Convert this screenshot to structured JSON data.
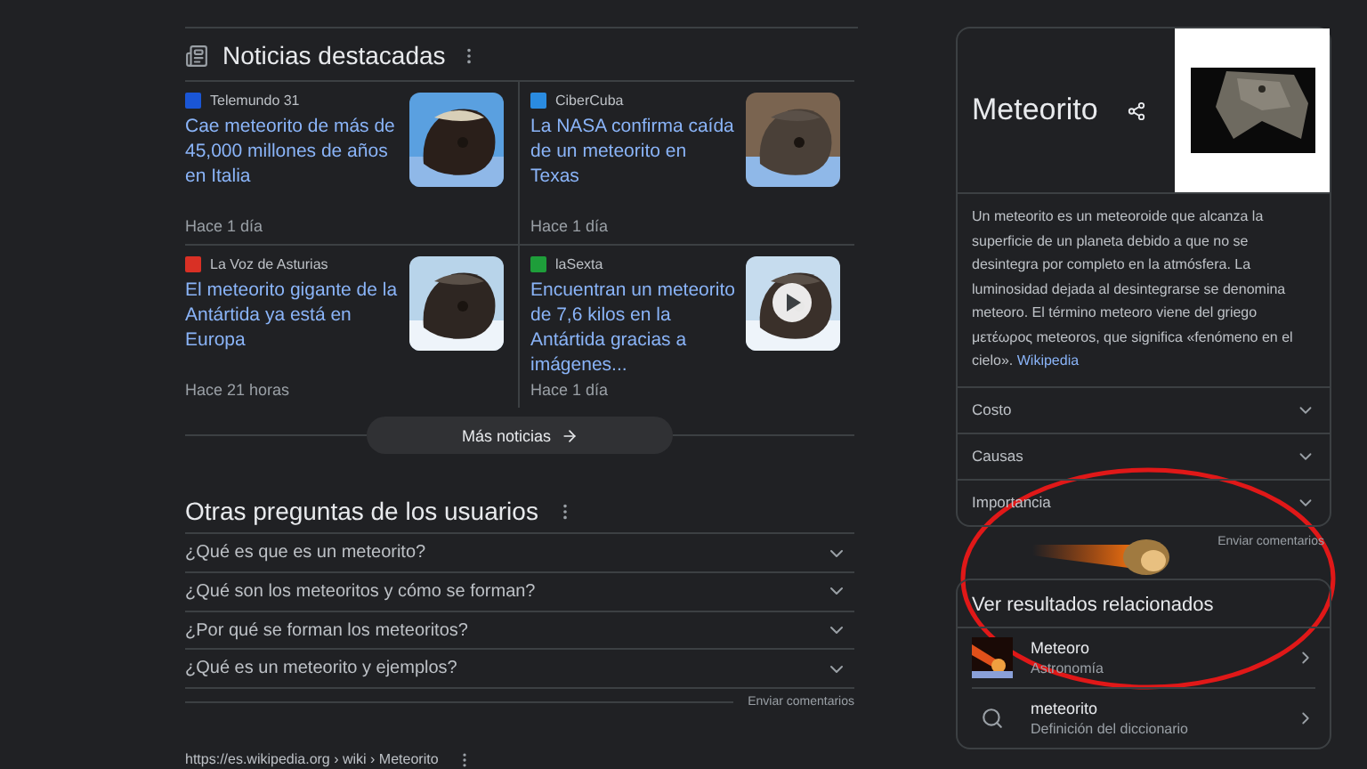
{
  "news": {
    "title": "Noticias destacadas",
    "items": [
      {
        "source": "Telemundo 31",
        "color": "#1a56d6",
        "headline": "Cae meteorito de más de 45,000 millones de años en Italia",
        "time": "Hace 1 día",
        "video": false
      },
      {
        "source": "CiberCuba",
        "color": "#2a8be0",
        "headline": "La NASA confirma caída de un meteorito en Texas",
        "time": "Hace 1 día",
        "video": false
      },
      {
        "source": "La Voz de Asturias",
        "color": "#d93025",
        "headline": "El meteorito gigante de la Antártida ya está en Europa",
        "time": "Hace 21 horas",
        "video": false
      },
      {
        "source": "laSexta",
        "color": "#1e9e3a",
        "headline": "Encuentran un meteorito de 7,6 kilos en la Antártida gracias a imágenes...",
        "time": "Hace 1 día",
        "video": true
      }
    ],
    "more_button": "Más noticias"
  },
  "questions": {
    "title": "Otras preguntas de los usuarios",
    "items": [
      {
        "text": "¿Qué es que es un meteorito?",
        "expanded": false
      },
      {
        "text": "¿Qué son los meteoritos y cómo se forman?",
        "expanded": false
      },
      {
        "text": "¿Por qué se forman los meteoritos?",
        "expanded": false
      },
      {
        "text": "¿Qué es un meteorito y ejemplos?",
        "expanded": false
      }
    ],
    "feedback": "Enviar comentarios"
  },
  "result": {
    "url": "https://es.wikipedia.org › wiki › Meteorito"
  },
  "knowledge_panel": {
    "title": "Meteorito",
    "description": "Un meteorito es un meteoroide que alcanza la superficie de un planeta debido a que no se desintegra por completo en la atmósfera. La luminosidad dejada al desintegrarse se denomina meteoro. El término meteoro viene del griego μετέωρος meteoros, que significa «fenómeno en el cielo».",
    "source_link": "Wikipedia",
    "sections": [
      {
        "label": "Costo",
        "expanded": false
      },
      {
        "label": "Causas",
        "expanded": false
      },
      {
        "label": "Importancia",
        "expanded": false
      }
    ],
    "feedback": "Enviar comentarios"
  },
  "related": {
    "title": "Ver resultados relacionados",
    "items": [
      {
        "kind": "thumbnail",
        "title": "Meteoro",
        "subtitle": "Astronomía"
      },
      {
        "kind": "search",
        "title": "meteorito",
        "subtitle": "Definición del diccionario"
      }
    ]
  }
}
